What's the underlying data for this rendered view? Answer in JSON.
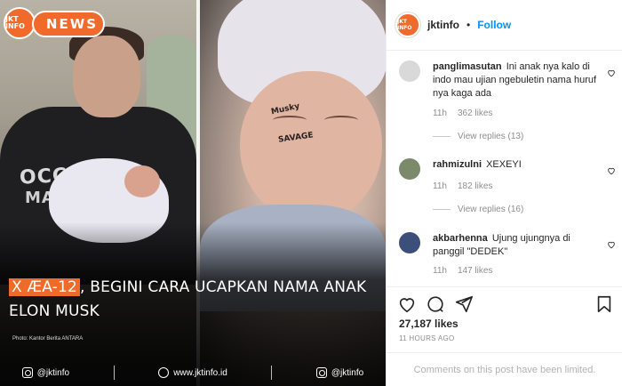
{
  "post": {
    "logo_text": "JKT INFO",
    "news_label": "NEWS",
    "headline_accent": "X ÆA-12",
    "headline_rest": ", BEGINI CARA UCAPKAN NAMA ANAK ELON MUSK",
    "photo_credit": "Photo: Kantor Berita ANTARA",
    "shirt_text_1": "OCCUPY",
    "shirt_text_2": "MAR",
    "baby_ink_1": "Musky",
    "baby_ink_2": "SAVAGE",
    "footer": {
      "instagram": "@jktinfo",
      "website": "www.jktinfo.id",
      "twitter": "@jktinfo"
    }
  },
  "header": {
    "avatar_text": "JKT INFO",
    "username": "jktinfo",
    "separator": "•",
    "follow_label": "Follow"
  },
  "comments": [
    {
      "username": "panglimasutan",
      "text": "Ini anak nya kalo di indo mau ujian ngebuletin nama huruf nya kaga ada",
      "time": "11h",
      "likes": "362 likes",
      "replies": "View replies (13)"
    },
    {
      "username": "rahmizulni",
      "text": "XEXEYI",
      "time": "11h",
      "likes": "182 likes",
      "replies": "View replies (16)"
    },
    {
      "username": "akbarhenna",
      "text": "Ujung ujungnya di panggil \"DEDEK\"",
      "time": "11h",
      "likes": "147 likes",
      "replies": ""
    }
  ],
  "actions": {
    "likes_count": "27,187 likes",
    "time_ago": "11 HOURS AGO",
    "comments_limited": "Comments on this post have been limited."
  },
  "colors": {
    "brand_orange": "#f06a2b",
    "follow_blue": "#0095f6",
    "muted_gray": "#8e8e8e"
  }
}
